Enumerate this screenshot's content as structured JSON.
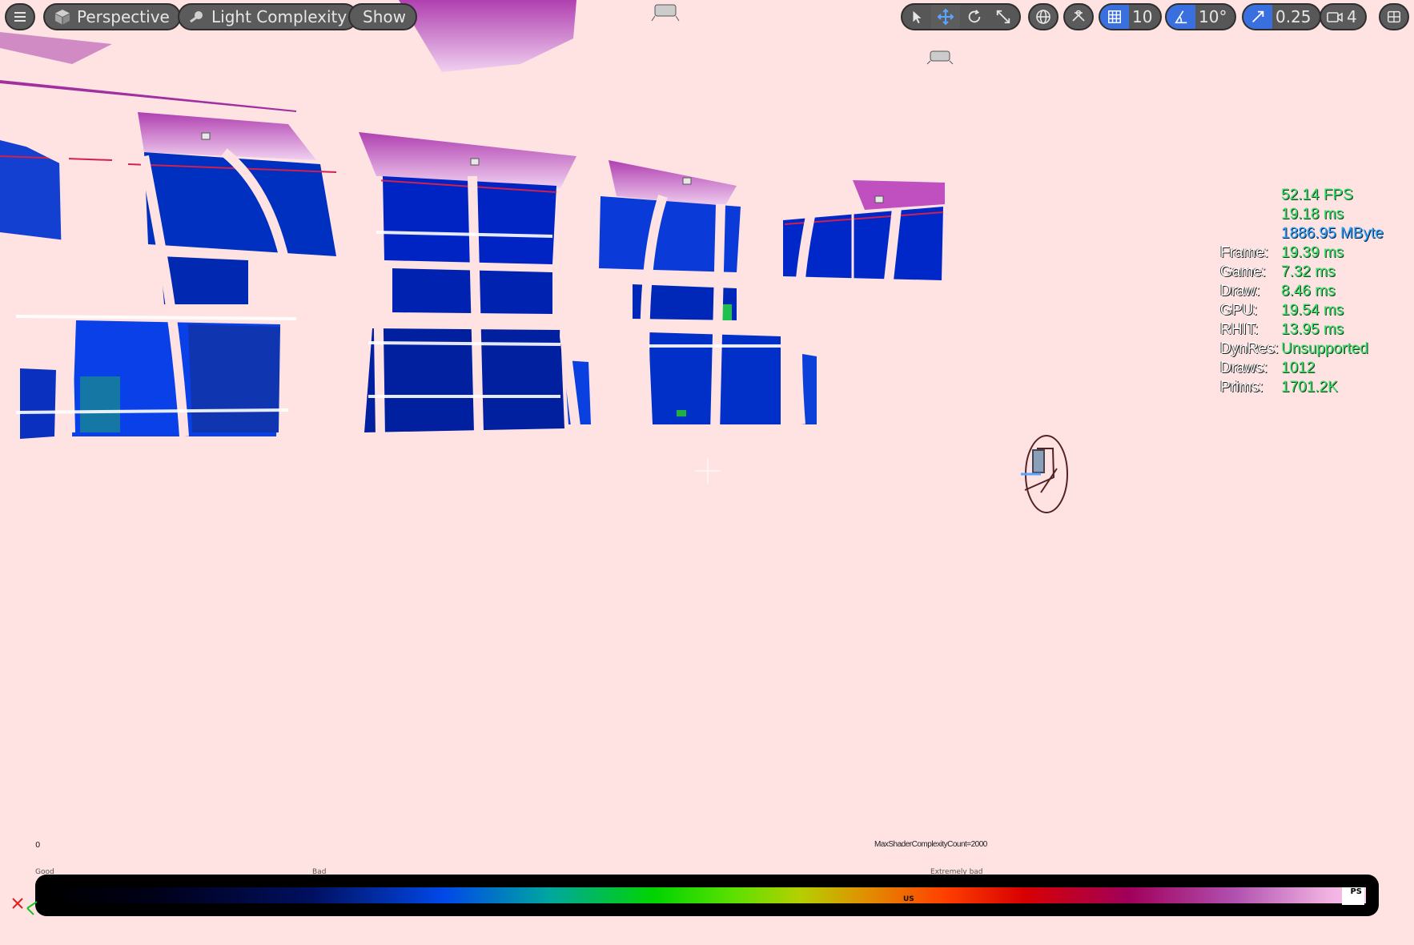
{
  "viewport_mode": "Perspective",
  "view_mode": "Light Complexity",
  "show_label": "Show",
  "toolbar": {
    "grid_snap_value": "10",
    "rotation_snap_value": "10°",
    "scale_snap_value": "0.25",
    "camera_speed_value": "4"
  },
  "stats": {
    "fps": "52.14 FPS",
    "frame_ms": "19.18 ms",
    "memory": "1886.95 MByte",
    "rows": [
      {
        "label": "Frame:",
        "value": "19.39 ms"
      },
      {
        "label": "Game:",
        "value": "7.32 ms"
      },
      {
        "label": "Draw:",
        "value": "8.46 ms"
      },
      {
        "label": "GPU:",
        "value": "19.54 ms"
      },
      {
        "label": "RHIT:",
        "value": "13.95 ms"
      },
      {
        "label": "DynRes:",
        "value": "Unsupported"
      },
      {
        "label": "Draws:",
        "value": "1012"
      },
      {
        "label": "Prims:",
        "value": "1701.2K"
      }
    ]
  },
  "legend": {
    "min_label": "0",
    "max_label": "MaxShaderComplexityCount=2000",
    "good_label": "Good",
    "bad_label": "Bad",
    "extremely_bad_label": "Extremely bad",
    "us_label": "US",
    "ps_label": "PS"
  },
  "colors": {
    "background": "#ffe3e3",
    "toolbar_pill": "#5b5b5b",
    "accent_blue": "#3a6fe0",
    "stat_green": "#34e06a",
    "stat_cyan": "#2aa5ff"
  }
}
